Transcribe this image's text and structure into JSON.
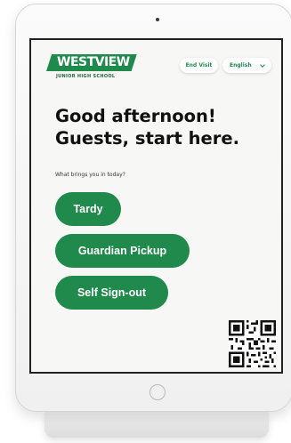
{
  "device": {
    "camera_icon": "camera-dot",
    "home_button_icon": "home-button-circle"
  },
  "header": {
    "logo_text": "WESTVIEW",
    "logo_subtitle": "JUNIOR HIGH SCHOOL",
    "end_visit_label": "End Visit",
    "language_value": "English",
    "language_icon": "chevron-down-icon"
  },
  "main": {
    "greeting_line1": "Good afternoon!",
    "greeting_line2": "Guests, start here.",
    "prompt": "What brings you in today?",
    "actions": [
      {
        "label": "Tardy"
      },
      {
        "label": "Guardian Pickup"
      },
      {
        "label": "Self Sign-out"
      }
    ]
  },
  "qr_code": {
    "icon": "qr-code"
  },
  "colors": {
    "brand_green": "#1f8a4c",
    "screen_background": "#f7f7f5",
    "text_primary": "#111111"
  }
}
